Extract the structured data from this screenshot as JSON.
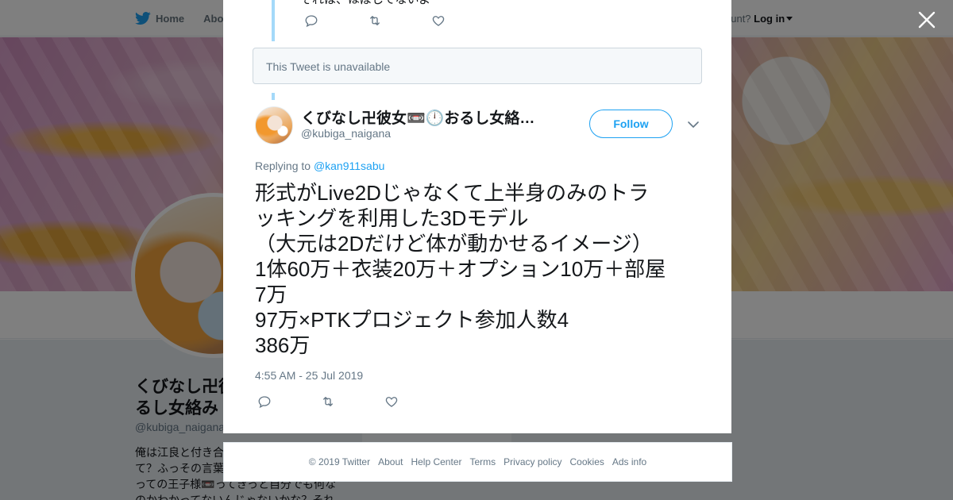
{
  "nav": {
    "home_label": "Home",
    "about_partial": "Abo",
    "account_prompt": "ccount?",
    "login_label": "Log in"
  },
  "background_profile": {
    "display_name": "くびなし卍彼女📼🕛お\nるし女絡み",
    "handle": "@kubiga_naigana",
    "bio": "俺は江良と付き合\nて？ふっその言葉\nっての王子様📼ってきっと自分でも何な\nのかわかってないんじゃないかな？それ"
  },
  "modal": {
    "partial_previous_text": "それは、ほぼしてないよ",
    "unavailable_text": "This Tweet is unavailable",
    "tweet": {
      "author_name": "くびなし卍彼女📼🕛おるし女絡…",
      "author_handle": "@kubiga_naigana",
      "follow_label": "Follow",
      "replying_to_prefix": "Replying to",
      "replying_to_handle": "@kan911sabu",
      "text_lines": [
        "形式がLive2Dじゃなくて上半身のみのトラ",
        "ッキングを利用した3Dモデル",
        "（大元は2Dだけど体が動かせるイメージ）",
        "1体60万＋衣装20万＋オプション10万＋部屋",
        "7万",
        "97万×PTKプロジェクト参加人数4",
        "386万"
      ],
      "timestamp": "4:55 AM - 25 Jul 2019"
    }
  },
  "footer": {
    "copyright": "© 2019 Twitter",
    "links": [
      "About",
      "Help Center",
      "Terms",
      "Privacy policy",
      "Cookies",
      "Ads info"
    ]
  },
  "colors": {
    "accent": "#1da1f2",
    "thread_line": "#a4d9f9",
    "muted_text": "#657786",
    "overlay": "rgba(0,0,0,0.5)"
  },
  "icons": [
    "twitter-bird-icon",
    "caret-down-icon",
    "close-icon",
    "reply-icon",
    "retweet-icon",
    "like-icon",
    "chevron-down-icon"
  ]
}
